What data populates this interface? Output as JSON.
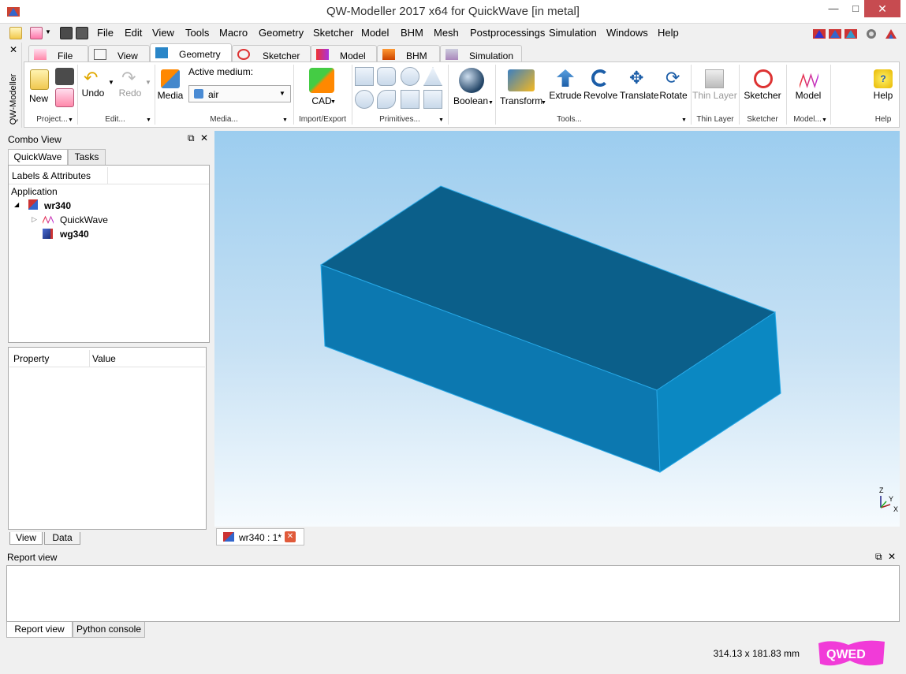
{
  "window": {
    "title": "QW-Modeller 2017 x64 for QuickWave [in metal]"
  },
  "menu": {
    "items": [
      "File",
      "Edit",
      "View",
      "Tools",
      "Macro",
      "Geometry",
      "Sketcher",
      "Model",
      "BHM",
      "Mesh",
      "Postprocessings",
      "Simulation",
      "Windows",
      "Help"
    ]
  },
  "ribbon": {
    "side_label": "QW-Modeller",
    "tabs": [
      "File",
      "View",
      "Geometry",
      "Sketcher",
      "Model",
      "BHM",
      "Simulation"
    ],
    "active_tab": "Geometry",
    "buttons": {
      "new": "New",
      "undo": "Undo",
      "redo": "Redo",
      "media": "Media",
      "active_medium_label": "Active medium:",
      "active_medium_value": "air",
      "cad": "CAD",
      "boolean": "Boolean",
      "transform": "Transform",
      "extrude": "Extrude",
      "revolve": "Revolve",
      "translate": "Translate",
      "rotate": "Rotate",
      "thin_layer": "Thin Layer",
      "sketcher": "Sketcher",
      "model": "Model",
      "help": "Help"
    },
    "groups": [
      "Project...",
      "Edit...",
      "Media...",
      "Import/Export",
      "Primitives...",
      "Tools...",
      "Thin Layer",
      "Sketcher",
      "Model...",
      "Help"
    ]
  },
  "combo_view": {
    "title": "Combo View",
    "tabs": [
      "QuickWave",
      "Tasks"
    ],
    "tree_header": "Labels & Attributes",
    "tree": {
      "root": "Application",
      "doc": "wr340",
      "child1": "QuickWave",
      "child2": "wg340"
    },
    "prop_columns": [
      "Property",
      "Value"
    ],
    "bottom_tabs": [
      "View",
      "Data"
    ]
  },
  "viewport": {
    "axis": {
      "z": "Z",
      "y": "Y",
      "x": "X"
    },
    "doc_tab": "wr340 : 1*"
  },
  "report": {
    "title": "Report view",
    "tabs": [
      "Report view",
      "Python console"
    ]
  },
  "status": {
    "dimensions": "314.13 x 181.83 mm"
  },
  "colors": {
    "box_top": "#0b5f8a",
    "box_front": "#0c7ab2",
    "box_side": "#0b8cc4",
    "close_red": "#c74b50"
  }
}
